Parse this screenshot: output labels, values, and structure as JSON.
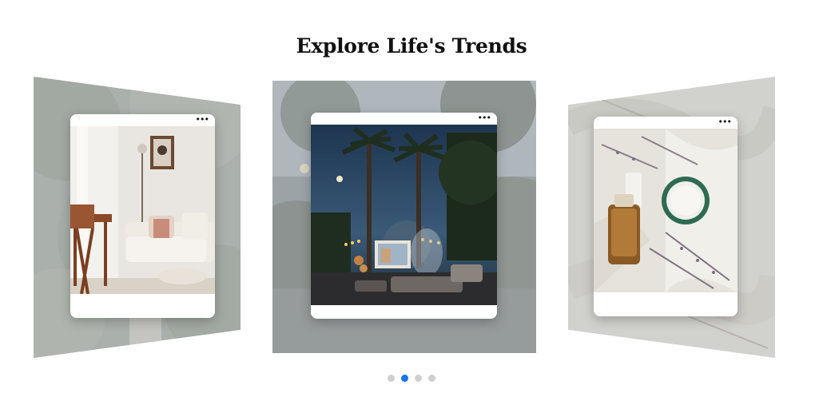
{
  "page": {
    "title": "Explore Life's Trends"
  },
  "carousel": {
    "slides": [
      {
        "position": "left",
        "photo": "living-room-image"
      },
      {
        "position": "center",
        "photo": "outdoor-movie-night-image"
      },
      {
        "position": "right",
        "photo": "candle-and-lavender-image"
      }
    ],
    "card_menu_icon": "more-horizontal-icon",
    "card_menu_glyph": "•••",
    "active_index": 1,
    "pagination_count": 4
  },
  "colors": {
    "active_dot": "#1a73e8",
    "inactive_dot": "#cfcfcf"
  }
}
